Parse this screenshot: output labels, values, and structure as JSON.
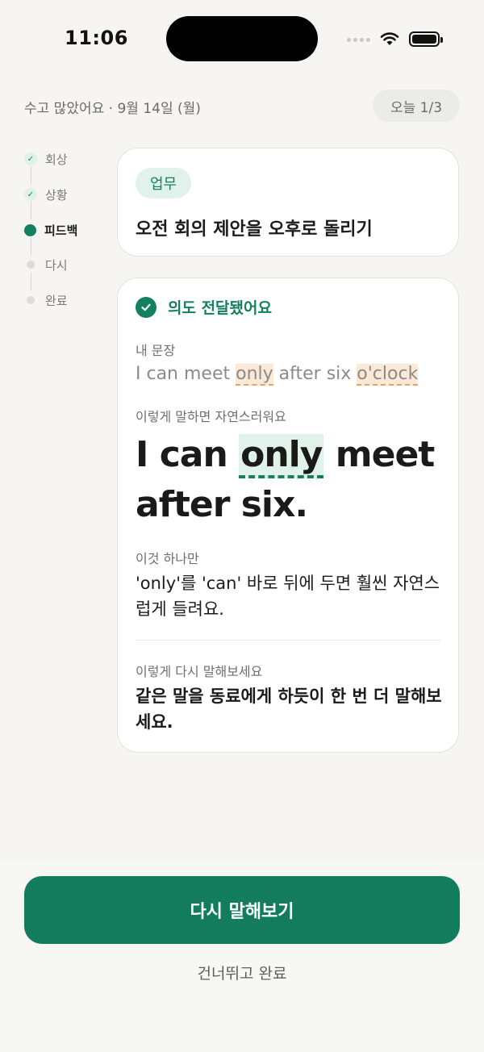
{
  "status_bar": {
    "time": "11:06"
  },
  "header": {
    "greeting_date": "수고 많았어요 · 9월 14일 (월)",
    "progress_pill": "오늘 1/3"
  },
  "stepper": {
    "steps": [
      {
        "label": "회상",
        "state": "done"
      },
      {
        "label": "상황",
        "state": "done"
      },
      {
        "label": "피드백",
        "state": "active"
      },
      {
        "label": "다시",
        "state": "todo"
      },
      {
        "label": "완료",
        "state": "todo"
      }
    ]
  },
  "task": {
    "tag": "업무",
    "title": "오전 회의 제안을 오후로 돌리기"
  },
  "feedback": {
    "status": "의도 전달됐어요",
    "my_sentence_label": "내 문장",
    "my_sentence": {
      "part1": "I can meet ",
      "hl1": "only",
      "part2": " after six ",
      "hl2": "o'clock"
    },
    "natural_label": "이렇게 말하면 자연스러워요",
    "natural_sentence": {
      "part1": "I can ",
      "hl": "only",
      "part2": " meet after six."
    },
    "tip_label": "이것 하나만",
    "tip_text": "'only'를 'can' 바로 뒤에 두면 훨씬 자연스럽게 들려요.",
    "retry_label": "이렇게 다시 말해보세요",
    "retry_text": "같은 말을 동료에게 하듯이 한 번 더 말해보세요."
  },
  "actions": {
    "primary": "다시 말해보기",
    "secondary": "건너뛰고 완료"
  },
  "colors": {
    "accent": "#127c5c",
    "accent_soft": "#e1f2ea",
    "warm_highlight": "#fbe9d6",
    "background": "#f6f5f2"
  },
  "icons": [
    "wifi-icon",
    "battery-icon",
    "check-icon",
    "check-circle-icon"
  ]
}
